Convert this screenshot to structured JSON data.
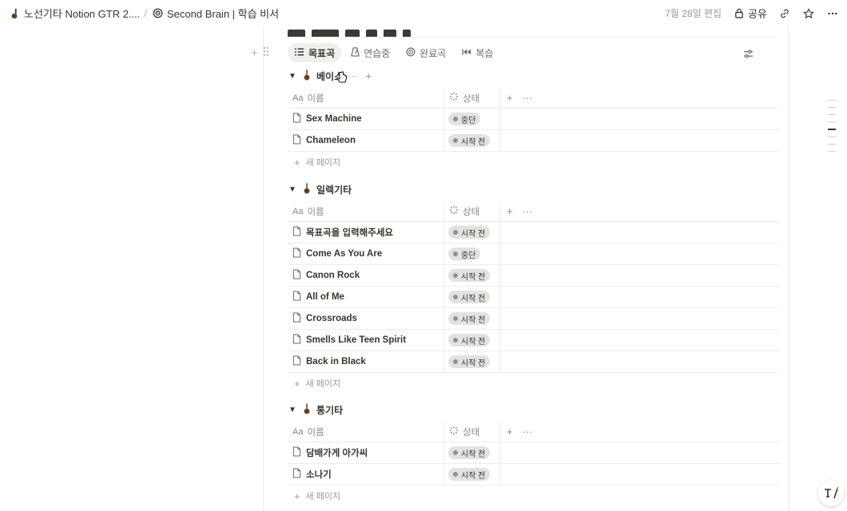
{
  "topbar": {
    "breadcrumb": [
      {
        "icon": "guitar-icon",
        "label": "노선기타 Notion GTR 2...."
      },
      {
        "icon": "target-icon",
        "label": "Second Brain | 학습 비서"
      }
    ],
    "edited": "7월 28일 편집",
    "share_label": "공유"
  },
  "views": [
    {
      "icon": "list-icon",
      "label": "목표곡",
      "active": true
    },
    {
      "icon": "metronome-icon",
      "label": "연습중",
      "active": false
    },
    {
      "icon": "target-icon",
      "label": "완료곡",
      "active": false
    },
    {
      "icon": "rewind-icon",
      "label": "복습",
      "active": false
    }
  ],
  "columns": {
    "name": "이름",
    "status": "상태"
  },
  "new_page_label": "새 페이지",
  "groups": [
    {
      "name": "베이스",
      "rows": [
        {
          "name": "Sex Machine",
          "status": "중단"
        },
        {
          "name": "Chameleon",
          "status": "시작 전"
        }
      ]
    },
    {
      "name": "일렉기타",
      "rows": [
        {
          "name": "목표곡을 입력해주세요",
          "status": "시작 전"
        },
        {
          "name": "Come As You Are",
          "status": "중단"
        },
        {
          "name": "Canon Rock",
          "status": "시작 전"
        },
        {
          "name": "All of Me",
          "status": "시작 전"
        },
        {
          "name": "Crossroads",
          "status": "시작 전"
        },
        {
          "name": "Smells Like Teen Spirit",
          "status": "시작 전"
        },
        {
          "name": "Back in Black",
          "status": "시작 전"
        }
      ]
    },
    {
      "name": "통기타",
      "rows": [
        {
          "name": "담배가게 아가씨",
          "status": "시작 전"
        },
        {
          "name": "소나기",
          "status": "시작 전"
        }
      ]
    }
  ],
  "colors": {
    "text": "#37352f",
    "muted": "#9b9a97",
    "pill": "#e3e2e0",
    "border": "#ececeb"
  }
}
